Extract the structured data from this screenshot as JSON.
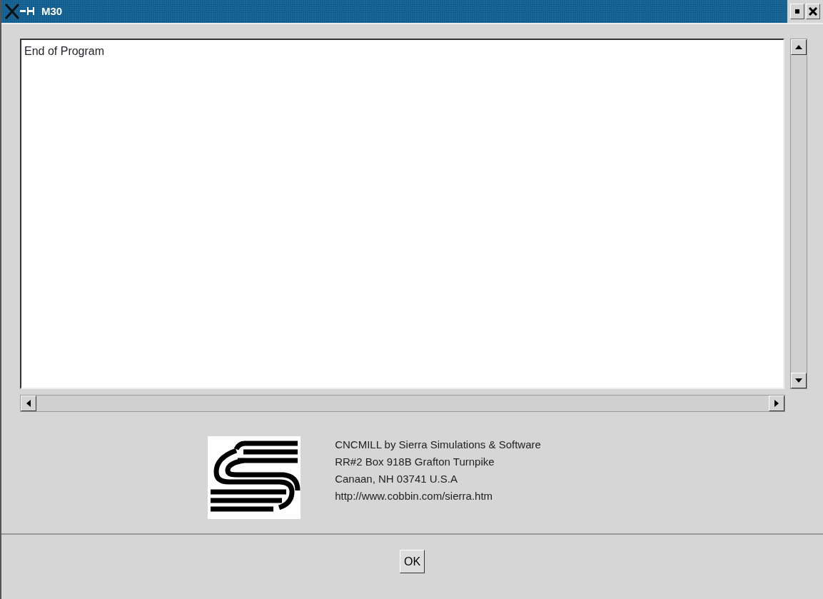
{
  "window": {
    "title": "M30"
  },
  "text_area": {
    "lines": [
      "End of Program"
    ]
  },
  "about": {
    "lines": [
      "CNCMILL by Sierra Simulations & Software",
      "RR#2 Box 918B Grafton Turnpike",
      "Canaan, NH 03741 U.S.A",
      "http://www.cobbin.com/sierra.htm"
    ]
  },
  "buttons": [
    {
      "label": "OK"
    }
  ]
}
